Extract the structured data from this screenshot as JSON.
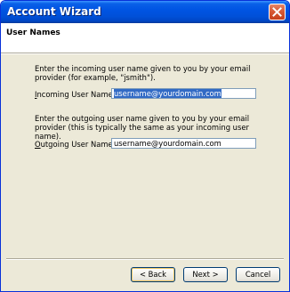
{
  "window": {
    "title": "Account Wizard"
  },
  "header": {
    "title": "User Names"
  },
  "incoming": {
    "description": "Enter the incoming user name given to you by your email provider (for example, \"jsmith\").",
    "label_access_key": "I",
    "label_rest": "ncoming User Name:",
    "value": "username@yourdomain.com"
  },
  "outgoing": {
    "description": "Enter the outgoing user name given to you by your email provider (this is typically the same as your incoming user name).",
    "label_access_key": "O",
    "label_rest": "utgoing User Name:",
    "value": "username@yourdomain.com"
  },
  "buttons": {
    "back": "< Back",
    "next": "Next >",
    "cancel": "Cancel"
  },
  "colors": {
    "titlebar": "#0054e3",
    "selection": "#316ac5",
    "close": "#d85a35"
  }
}
